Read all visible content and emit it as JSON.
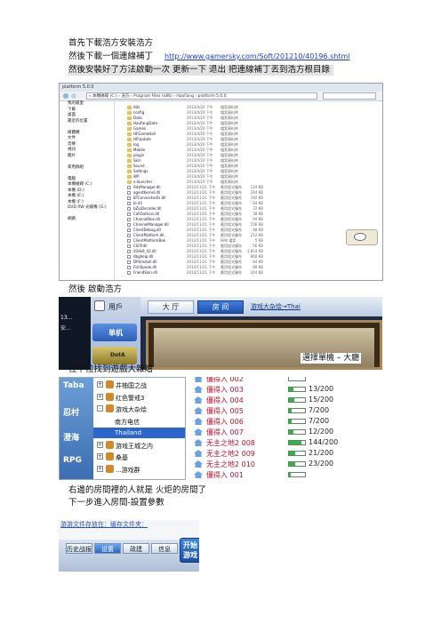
{
  "text": {
    "line1": "首先下載浩方安裝浩方",
    "line2_prefix": "然後下載一個連線補丁",
    "line2_link": "http://www.gamersky.com/Soft/201210/40196.shtml",
    "line3": "然後安裝好了方法啟動一次  更新一下  退出  把連線補丁丟到浩方根目錄",
    "line4": "然後  啟動浩方",
    "line5": "選擇單機 – 大廳",
    "line6": "往下拉找到遊戲大雜燴",
    "line7": "右邊的房間裡的人就是  火炬的房間了",
    "line8": "下一步進入房間-設置參數"
  },
  "explorer": {
    "title": "platform 5.0.0",
    "address": "« 本機磁碟 (C:) › 浩方 › Program Files (x86) › HaoFang › platform 5.0.0",
    "nav": [
      "我的最愛",
      "下載",
      "桌面",
      "最近的位置",
      "",
      "媒體櫃",
      "文件",
      "音樂",
      "視訊",
      "圖片",
      "",
      "家用群組",
      "",
      "電腦",
      "本機磁碟 (C:)",
      "本機 (D:)",
      "本機 (E:)",
      "本機 (F:)",
      "DVD RW 光碟機 (G:)",
      "",
      "網路"
    ],
    "rows": [
      {
        "n": "Ads",
        "d": "2013/4/20 下午",
        "t": "檔案資料夾",
        "s": "",
        "f": true
      },
      {
        "n": "config",
        "d": "2013/4/20 下午",
        "t": "檔案資料夾",
        "s": "",
        "f": true
      },
      {
        "n": "Data",
        "d": "2013/4/20 下午",
        "t": "檔案資料夾",
        "s": "",
        "f": true
      },
      {
        "n": "HaoFangData",
        "d": "2013/4/20 下午",
        "t": "檔案資料夾",
        "s": "",
        "f": true
      },
      {
        "n": "Games",
        "d": "2013/4/20 下午",
        "t": "檔案資料夾",
        "s": "",
        "f": true
      },
      {
        "n": "HFGameHall",
        "d": "2013/4/20 下午",
        "t": "檔案資料夾",
        "s": "",
        "f": true
      },
      {
        "n": "HFUpdate",
        "d": "2013/4/20 下午",
        "t": "檔案資料夾",
        "s": "",
        "f": true
      },
      {
        "n": "log",
        "d": "2013/4/20 下午",
        "t": "檔案資料夾",
        "s": "",
        "f": true
      },
      {
        "n": "Mobile",
        "d": "2013/4/20 下午",
        "t": "檔案資料夾",
        "s": "",
        "f": true
      },
      {
        "n": "plugin",
        "d": "2013/4/20 下午",
        "t": "檔案資料夾",
        "s": "",
        "f": true
      },
      {
        "n": "Skin",
        "d": "2013/4/20 下午",
        "t": "檔案資料夾",
        "s": "",
        "f": true
      },
      {
        "n": "Sound",
        "d": "2013/4/20 下午",
        "t": "檔案資料夾",
        "s": "",
        "f": true
      },
      {
        "n": "Settings",
        "d": "2013/4/20 下午",
        "t": "檔案資料夾",
        "s": "",
        "f": true
      },
      {
        "n": "WP",
        "d": "2013/4/20 下午",
        "t": "檔案資料夾",
        "s": "",
        "f": true
      },
      {
        "n": "x-launcher",
        "d": "2013/4/20 下午",
        "t": "檔案資料夾",
        "s": "",
        "f": true
      },
      {
        "n": "AdsManager.dll",
        "d": "2012/11/21 下午",
        "t": "應用程式擴充",
        "s": "124 KB",
        "f": false
      },
      {
        "n": "agentKernel.dll",
        "d": "2012/11/21 下午",
        "t": "應用程式擴充",
        "s": "244 KB",
        "f": false
      },
      {
        "n": "BTConnectorEx.dll",
        "d": "2012/11/21 下午",
        "t": "應用程式擴充",
        "s": "192 KB",
        "f": false
      },
      {
        "n": "bi.dll",
        "d": "2012/11/21 下午",
        "t": "應用程式擴充",
        "s": "64 KB",
        "f": false
      },
      {
        "n": "bZipDecoder.dll",
        "d": "2012/11/21 下午",
        "t": "應用程式擴充",
        "s": "72 KB",
        "f": false
      },
      {
        "n": "CallOutIcon.dll",
        "d": "2012/11/21 下午",
        "t": "應用程式擴充",
        "s": "38 KB",
        "f": false
      },
      {
        "n": "ChannelBox.dll",
        "d": "2012/11/21 下午",
        "t": "應用程式擴充",
        "s": "94 KB",
        "f": false
      },
      {
        "n": "ChannelManager.dll",
        "d": "2012/11/21 下午",
        "t": "應用程式擴充",
        "s": "156 KB",
        "f": false
      },
      {
        "n": "ClientDebug.dll",
        "d": "2012/11/21 下午",
        "t": "應用程式擴充",
        "s": "48 KB",
        "f": false
      },
      {
        "n": "ClientPlatform.dll",
        "d": "2012/11/21 下午",
        "t": "應用程式擴充",
        "s": "212 KB",
        "f": false
      },
      {
        "n": "ClientPlatformBak",
        "d": "2012/11/21 下午",
        "t": "BAK 檔案",
        "s": "5 KB",
        "f": false
      },
      {
        "n": "CSFP.dll",
        "d": "2012/11/21 下午",
        "t": "應用程式擴充",
        "s": "56 KB",
        "f": false
      },
      {
        "n": "d3dx9_42.dll",
        "d": "2012/11/21 下午",
        "t": "應用程式擴充",
        "s": "1,854 KB",
        "f": false
      },
      {
        "n": "dbghelp.dll",
        "d": "2012/11/21 下午",
        "t": "應用程式擴充",
        "s": "860 KB",
        "f": false
      },
      {
        "n": "DPUInstall.dll",
        "d": "2012/11/21 下午",
        "t": "應用程式擴充",
        "s": "84 KB",
        "f": false
      },
      {
        "n": "FishSpeak.dll",
        "d": "2012/11/21 下午",
        "t": "應用程式擴充",
        "s": "80 KB",
        "f": false
      },
      {
        "n": "FriendSkin.dll",
        "d": "2012/11/21 下午",
        "t": "應用程式擴充",
        "s": "244 KB",
        "f": false
      }
    ]
  },
  "launcher": {
    "user_tab": "用戶",
    "hall_tab": "大 厅",
    "room_tab": "房 间",
    "notice": "游戏大杂烩→Thai",
    "left_text1": "13...",
    "left_text2": "安...",
    "single_btn": "单机",
    "dota_btn": "DotA"
  },
  "tree": {
    "side": [
      "Taba",
      "忍村",
      "澄海",
      "RPG"
    ],
    "items": [
      {
        "label": "井柚国之战",
        "level": 1,
        "exp": "+"
      },
      {
        "label": "红色警戒3",
        "level": 1,
        "exp": "+"
      },
      {
        "label": "游戏大杂烩",
        "level": 1,
        "exp": "-"
      },
      {
        "label": "南方电信",
        "level": 2,
        "exp": ""
      },
      {
        "label": "Thailand",
        "level": 2,
        "exp": "",
        "sel": true
      },
      {
        "label": "游戏王城之内",
        "level": 1,
        "exp": "+"
      },
      {
        "label": "桑基",
        "level": 1,
        "exp": "+"
      },
      {
        "label": "...游戏群",
        "level": 1,
        "exp": "+"
      }
    ]
  },
  "rooms": [
    {
      "name": "僵得入 002",
      "count": "",
      "bar": 0.0
    },
    {
      "name": "僵得入 003",
      "count": "13/200",
      "bar": 0.3
    },
    {
      "name": "僵得入 004",
      "count": "15/200",
      "bar": 0.35
    },
    {
      "name": "僵得入 005",
      "count": "7/200",
      "bar": 0.15
    },
    {
      "name": "僵得入 006",
      "count": "7/200",
      "bar": 0.15
    },
    {
      "name": "僵得入 007",
      "count": "12/200",
      "bar": 0.3
    },
    {
      "name": "无主之地2 008",
      "count": "144/200",
      "bar": 0.75
    },
    {
      "name": "无主之地2 009",
      "count": "21/200",
      "bar": 0.4
    },
    {
      "name": "无主之地2 010",
      "count": "23/200",
      "bar": 0.4
    },
    {
      "name": "僵得入 001",
      "count": "",
      "bar": 0.1
    }
  ],
  "bottom": {
    "top_text": "游游文件存放在：缓存文件夹：",
    "btns": [
      "历史战报",
      "设置",
      "政建",
      "信息"
    ],
    "start1": "开始",
    "start2": "游戏"
  },
  "colors": {
    "accent": "#3a7bd5",
    "room_red": "#c0102e",
    "selected": "#2a66cc"
  }
}
